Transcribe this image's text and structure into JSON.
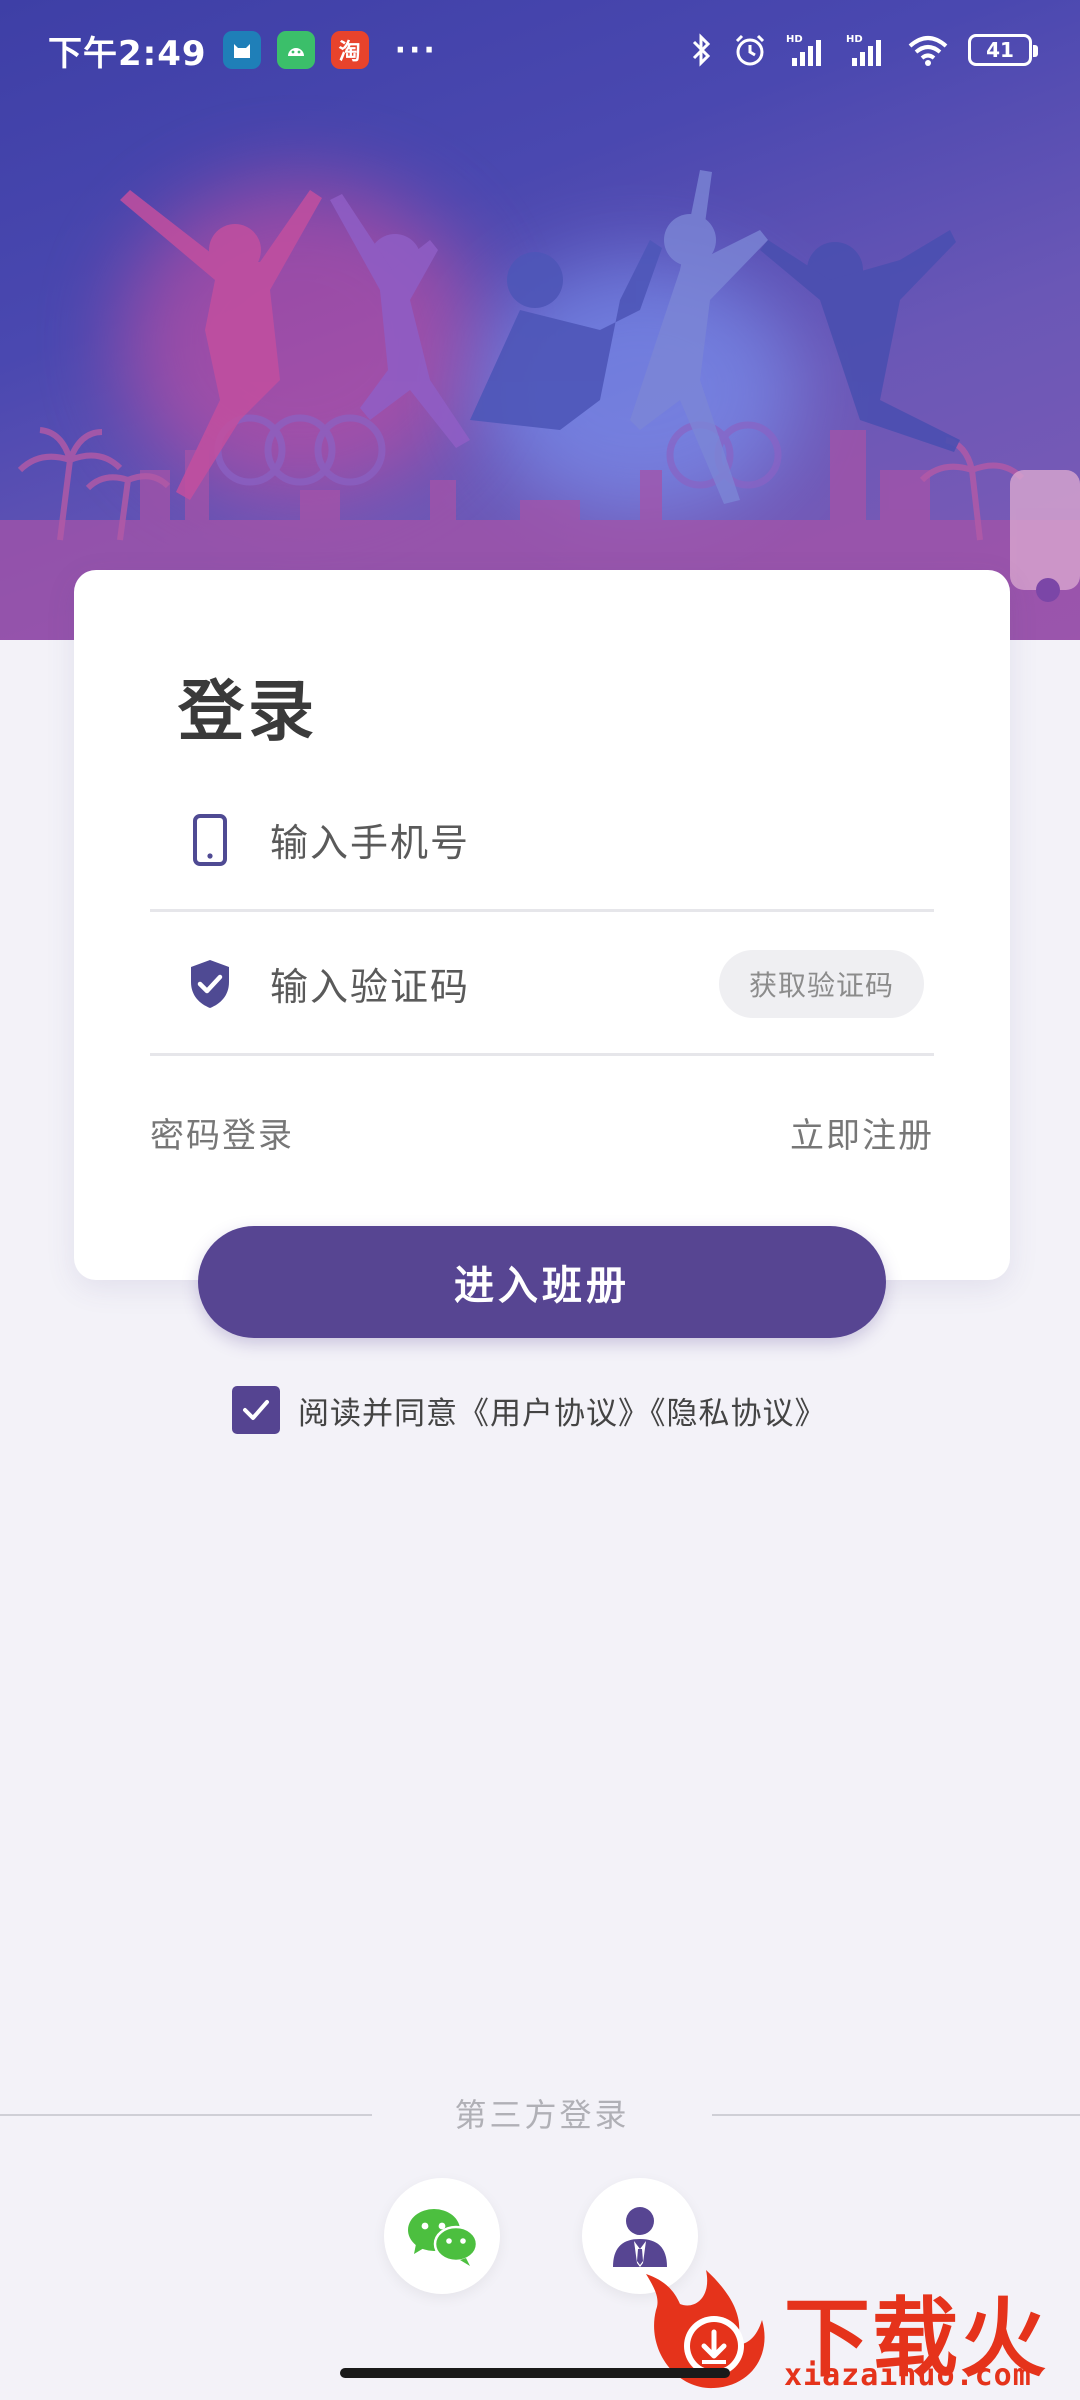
{
  "status_bar": {
    "time": "下午2:49",
    "app_icons": [
      "cat-app-icon",
      "android-icon",
      "taobao-icon"
    ],
    "app_badge_text": "淘",
    "overflow": "···",
    "battery": "41",
    "signal_label": "HD"
  },
  "login": {
    "title": "登录",
    "phone_placeholder": "输入手机号",
    "code_placeholder": "输入验证码",
    "get_code": "获取验证码",
    "password_login": "密码登录",
    "register": "立即注册"
  },
  "enter_button": "进入班册",
  "agreement": {
    "checked": true,
    "text": "阅读并同意《用户协议》《隐私协议》"
  },
  "third_party": {
    "label": "第三方登录",
    "providers": [
      "wechat-icon",
      "agent-icon"
    ]
  },
  "watermark": {
    "title": "下载火",
    "domain": "xiazaihuo.com"
  },
  "colors": {
    "primary": "#574592",
    "banner_start": "#3e3fa6",
    "banner_end": "#7f5bb6",
    "wechat_green": "#4cbf3f",
    "watermark_red": "#e5331b"
  }
}
